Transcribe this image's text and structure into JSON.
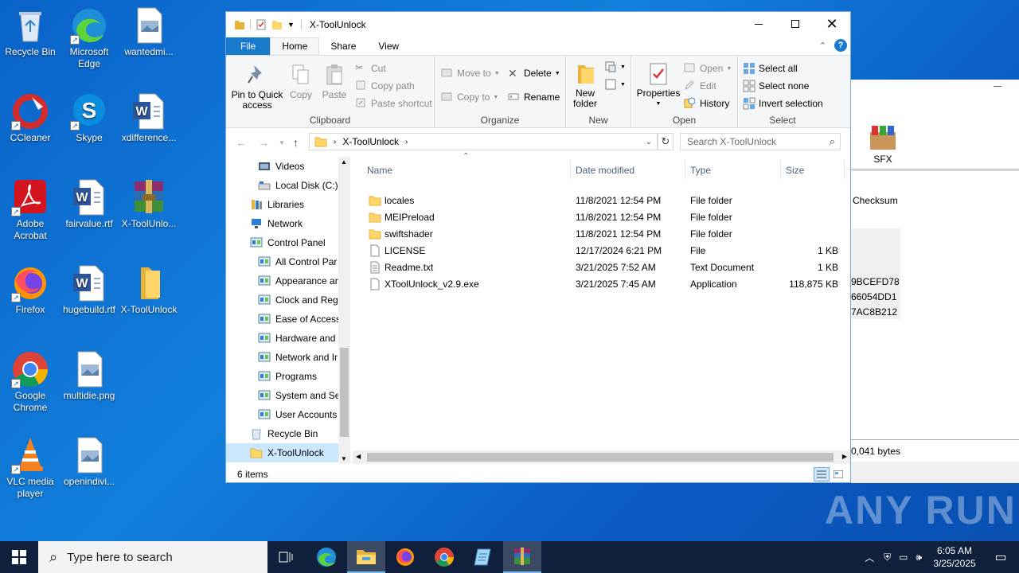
{
  "desktop": {
    "icons": [
      {
        "label": "Recycle Bin"
      },
      {
        "label": "Microsoft Edge"
      },
      {
        "label": "wantedmi..."
      },
      {
        "label": "CCleaner"
      },
      {
        "label": "Skype"
      },
      {
        "label": "xdifference..."
      },
      {
        "label": "Adobe Acrobat"
      },
      {
        "label": "fairvalue.rtf"
      },
      {
        "label": "X-ToolUnlo..."
      },
      {
        "label": "Firefox"
      },
      {
        "label": "hugebuild.rtf"
      },
      {
        "label": "X-ToolUnlock"
      },
      {
        "label": "Google Chrome"
      },
      {
        "label": "multidie.png"
      },
      {
        "label": "VLC media player"
      },
      {
        "label": "openindivi..."
      }
    ]
  },
  "bg_window": {
    "sfx_label": "SFX",
    "checksum_header": "Checksum",
    "checksums": [
      "9BCEFD78",
      "66054DD1",
      "7AC8B212"
    ],
    "status": "0,041 bytes"
  },
  "explorer": {
    "title": "X-ToolUnlock",
    "tabs": {
      "file": "File",
      "home": "Home",
      "share": "Share",
      "view": "View"
    },
    "ribbon": {
      "clipboard": {
        "label": "Clipboard",
        "pin": "Pin to Quick access",
        "copy": "Copy",
        "paste": "Paste",
        "cut": "Cut",
        "copy_path": "Copy path",
        "paste_shortcut": "Paste shortcut"
      },
      "organize": {
        "label": "Organize",
        "move_to": "Move to",
        "copy_to": "Copy to",
        "delete": "Delete",
        "rename": "Rename"
      },
      "new": {
        "label": "New",
        "new_folder": "New folder"
      },
      "open": {
        "label": "Open",
        "properties": "Properties",
        "open": "Open",
        "edit": "Edit",
        "history": "History"
      },
      "select": {
        "label": "Select",
        "select_all": "Select all",
        "select_none": "Select none",
        "invert": "Invert selection"
      }
    },
    "address": {
      "path": "X-ToolUnlock",
      "search_placeholder": "Search X-ToolUnlock"
    },
    "nav": [
      {
        "label": "Videos"
      },
      {
        "label": "Local Disk (C:)"
      },
      {
        "label": "Libraries"
      },
      {
        "label": "Network"
      },
      {
        "label": "Control Panel"
      },
      {
        "label": "All Control Par"
      },
      {
        "label": "Appearance an"
      },
      {
        "label": "Clock and Regi"
      },
      {
        "label": "Ease of Access"
      },
      {
        "label": "Hardware and"
      },
      {
        "label": "Network and Ir"
      },
      {
        "label": "Programs"
      },
      {
        "label": "System and Sec"
      },
      {
        "label": "User Accounts"
      },
      {
        "label": "Recycle Bin"
      },
      {
        "label": "X-ToolUnlock"
      }
    ],
    "columns": {
      "name": "Name",
      "date": "Date modified",
      "type": "Type",
      "size": "Size"
    },
    "files": [
      {
        "name": "locales",
        "date": "11/8/2021 12:54 PM",
        "type": "File folder",
        "size": "",
        "kind": "folder"
      },
      {
        "name": "MEIPreload",
        "date": "11/8/2021 12:54 PM",
        "type": "File folder",
        "size": "",
        "kind": "folder"
      },
      {
        "name": "swiftshader",
        "date": "11/8/2021 12:54 PM",
        "type": "File folder",
        "size": "",
        "kind": "folder"
      },
      {
        "name": "LICENSE",
        "date": "12/17/2024 6:21 PM",
        "type": "File",
        "size": "1 KB",
        "kind": "file"
      },
      {
        "name": "Readme.txt",
        "date": "3/21/2025 7:52 AM",
        "type": "Text Document",
        "size": "1 KB",
        "kind": "text"
      },
      {
        "name": "XToolUnlock_v2.9.exe",
        "date": "3/21/2025 7:45 AM",
        "type": "Application",
        "size": "118,875 KB",
        "kind": "exe"
      }
    ],
    "status": "6 items"
  },
  "taskbar": {
    "search_placeholder": "Type here to search",
    "time": "6:05 AM",
    "date": "3/25/2025"
  },
  "watermark": "ANY RUN"
}
